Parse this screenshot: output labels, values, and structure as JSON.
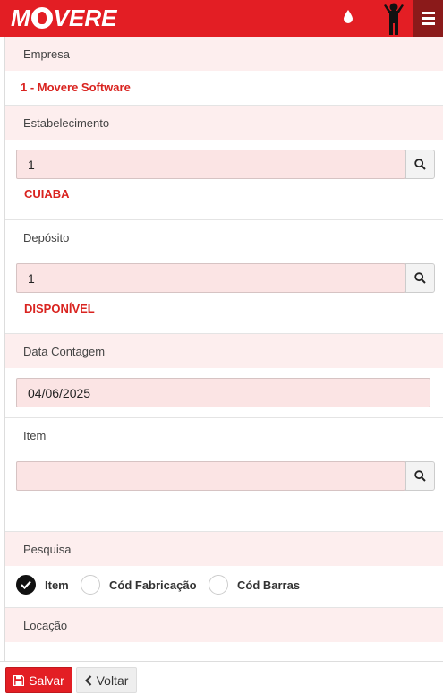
{
  "header": {
    "logo_text": "MOVERE",
    "colors": {
      "brand": "#e31e24",
      "menu_bg": "#8b1a1a"
    },
    "icons": [
      "drop-icon",
      "person-icon",
      "hamburger-menu-icon"
    ]
  },
  "form": {
    "empresa": {
      "label": "Empresa",
      "value": "1 - Movere Software"
    },
    "estabelecimento": {
      "label": "Estabelecimento",
      "value": "1",
      "description": "CUIABA"
    },
    "deposito": {
      "label": "Depósito",
      "value": "1",
      "description": "DISPONÍVEL"
    },
    "data_contagem": {
      "label": "Data Contagem",
      "value": "04/06/2025"
    },
    "item": {
      "label": "Item",
      "value": ""
    },
    "pesquisa": {
      "label": "Pesquisa",
      "options": [
        {
          "label": "Item",
          "checked": true
        },
        {
          "label": "Cód Fabricação",
          "checked": false
        },
        {
          "label": "Cód Barras",
          "checked": false
        }
      ]
    },
    "locacao": {
      "label": "Locação"
    }
  },
  "footer": {
    "save_label": "Salvar",
    "back_label": "Voltar"
  }
}
